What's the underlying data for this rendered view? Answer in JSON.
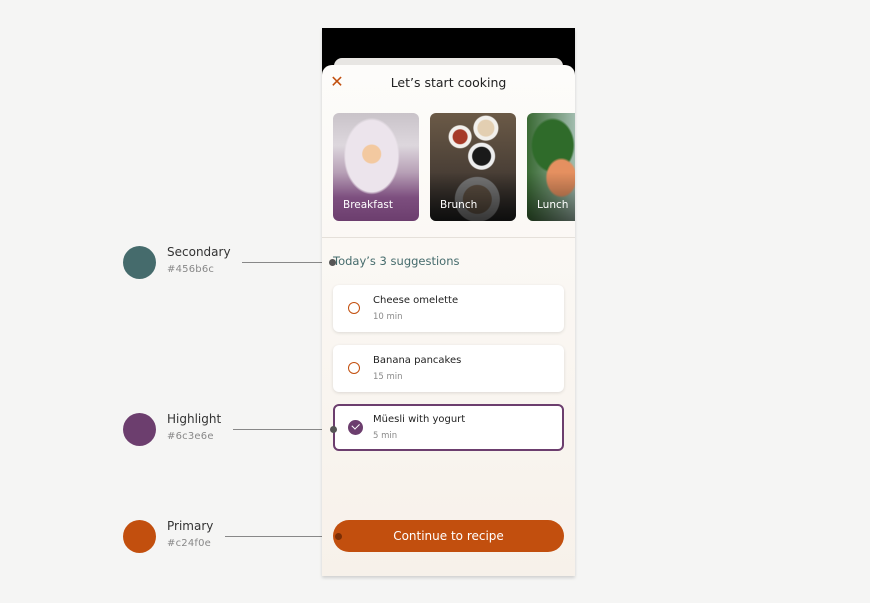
{
  "legend": [
    {
      "name": "Secondary",
      "hex": "#456b6c",
      "color": "#456b6c"
    },
    {
      "name": "Highlight",
      "hex": "#6c3e6e",
      "color": "#6c3e6e"
    },
    {
      "name": "Primary",
      "hex": "#c24f0e",
      "color": "#c24f0e"
    }
  ],
  "sheet": {
    "close_icon": "close-icon",
    "title": "Let’s start cooking",
    "categories": [
      {
        "label": "Breakfast"
      },
      {
        "label": "Brunch"
      },
      {
        "label": "Lunch"
      }
    ],
    "suggestions_title": "Today’s 3 suggestions",
    "suggestions": [
      {
        "name": "Cheese omelette",
        "time": "10 min",
        "selected": false
      },
      {
        "name": "Banana pancakes",
        "time": "15 min",
        "selected": false
      },
      {
        "name": "Müesli with yogurt",
        "time": "5 min",
        "selected": true
      }
    ],
    "cta_label": "Continue to recipe"
  }
}
